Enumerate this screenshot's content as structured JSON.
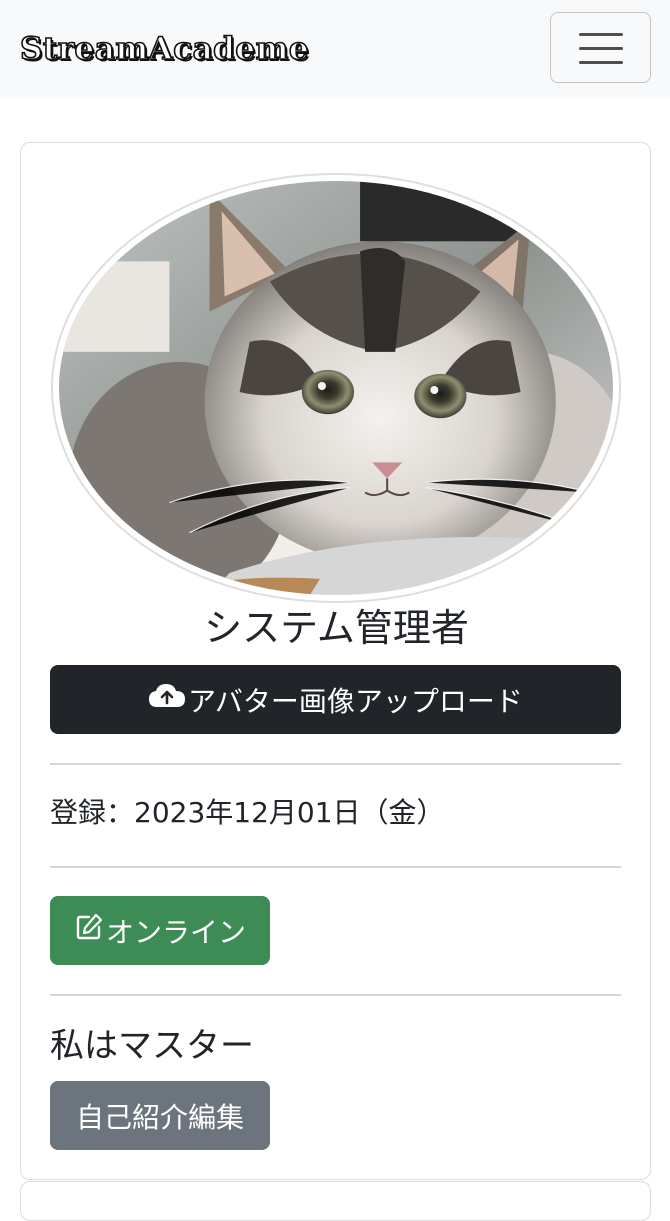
{
  "navbar": {
    "brand": "StreamAcademe",
    "toggler_icon": "hamburger-menu-icon"
  },
  "profile": {
    "avatar_alt": "kitten-photo",
    "name": "システム管理者",
    "upload_button": {
      "icon": "cloud-upload-icon",
      "label": "アバター画像アップロード"
    },
    "registered": "登録：2023年12月01日（金）",
    "status_button": {
      "icon": "pencil-square-icon",
      "label": "オンライン"
    },
    "bio": "私はマスター",
    "edit_bio_button": {
      "label": "自己紹介編集"
    }
  },
  "colors": {
    "upload_button": "#212529",
    "status_button": "#3d8b55",
    "edit_button": "#6c757d",
    "navbar_bg": "#f8f9fa"
  }
}
